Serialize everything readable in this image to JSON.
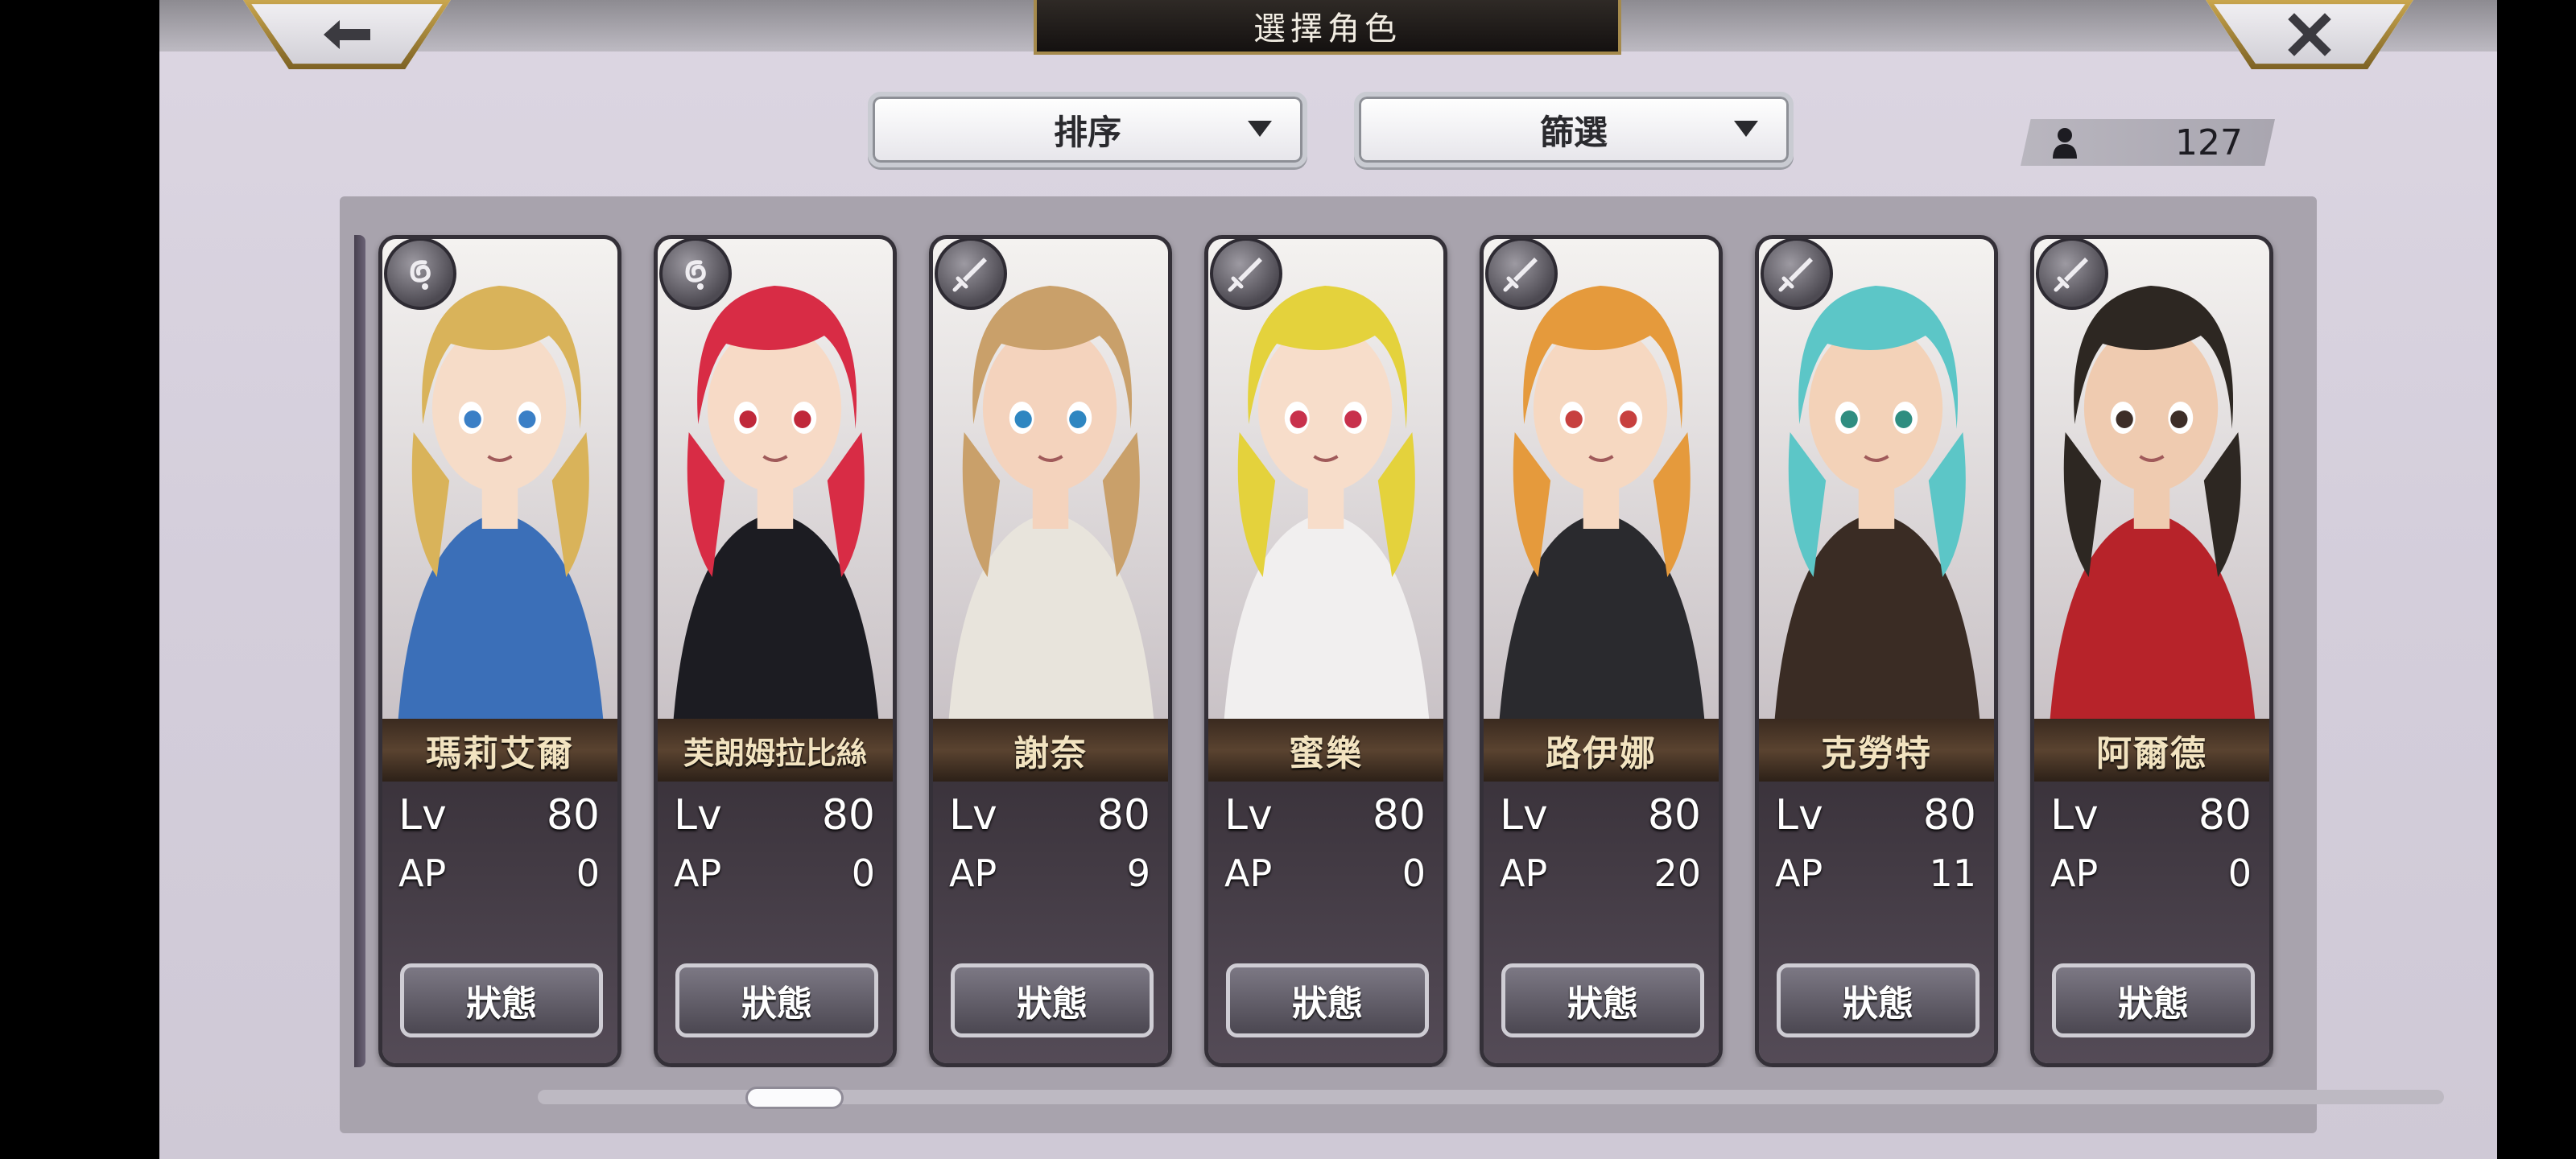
{
  "header": {
    "title": "選擇角色",
    "back_icon": "left-arrow",
    "close_icon": "x-mark"
  },
  "controls": {
    "sort_label": "排序",
    "filter_label": "篩選",
    "character_count": "127"
  },
  "stat_labels": {
    "lv": "Lv",
    "ap": "AP"
  },
  "status_label": "狀態",
  "characters": [
    {
      "name": "瑪莉艾爾",
      "lv": "80",
      "ap": "0",
      "type_icon": "spiral-icon",
      "hair": "#d9b35a",
      "outfit": "#3b6fb8",
      "skin": "#f6dcc8",
      "eyes": "#3a7fc6"
    },
    {
      "name": "芙朗姆拉比絲",
      "lv": "80",
      "ap": "0",
      "type_icon": "spiral-icon",
      "hair": "#d82c45",
      "outfit": "#1c1c22",
      "skin": "#f7dac6",
      "eyes": "#c0283a"
    },
    {
      "name": "謝奈",
      "lv": "80",
      "ap": "9",
      "type_icon": "sword-icon",
      "hair": "#c9a06a",
      "outfit": "#e8e4dc",
      "skin": "#f4d3bd",
      "eyes": "#2e86c1"
    },
    {
      "name": "蜜樂",
      "lv": "80",
      "ap": "0",
      "type_icon": "sword-icon",
      "hair": "#e4d23c",
      "outfit": "#f1efef",
      "skin": "#f7ddca",
      "eyes": "#c8314c"
    },
    {
      "name": "路伊娜",
      "lv": "80",
      "ap": "20",
      "type_icon": "sword-icon",
      "hair": "#e59a3c",
      "outfit": "#2a2a2e",
      "skin": "#f6d8c1",
      "eyes": "#c7403f"
    },
    {
      "name": "克勞特",
      "lv": "80",
      "ap": "11",
      "type_icon": "sword-icon",
      "hair": "#5cc6c7",
      "outfit": "#3a2c24",
      "skin": "#f3d2b8",
      "eyes": "#2f8d80"
    },
    {
      "name": "阿爾德",
      "lv": "80",
      "ap": "0",
      "type_icon": "sword-icon",
      "hair": "#2d2722",
      "outfit": "#b7232a",
      "skin": "#efcbb0",
      "eyes": "#3d2e28"
    }
  ]
}
